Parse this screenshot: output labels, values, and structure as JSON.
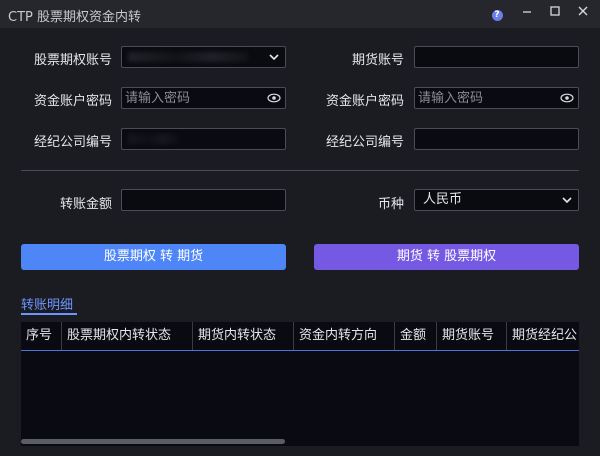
{
  "window": {
    "title": "CTP 股票期权资金内转"
  },
  "form": {
    "stock_account_label": "股票期权账号",
    "futures_account_label": "期货账号",
    "left_password_label": "资金账户密码",
    "left_password_placeholder": "请输入密码",
    "right_password_label": "资金账户密码",
    "right_password_placeholder": "请输入密码",
    "left_broker_label": "经纪公司编号",
    "right_broker_label": "经纪公司编号",
    "amount_label": "转账金额",
    "currency_label": "币种",
    "currency_value": "人民币"
  },
  "buttons": {
    "stock_to_futures": "股票期权 转 期货",
    "futures_to_stock": "期货 转 股票期权"
  },
  "details": {
    "tab_label": "转账明细",
    "columns": [
      "序号",
      "股票期权内转状态",
      "期货内转状态",
      "资金内转方向",
      "金额",
      "期货账号",
      "期货经纪公"
    ]
  },
  "colors": {
    "accent_blue": "#4e86f7",
    "accent_purple": "#7559e3",
    "tab_blue": "#6d95ff"
  }
}
